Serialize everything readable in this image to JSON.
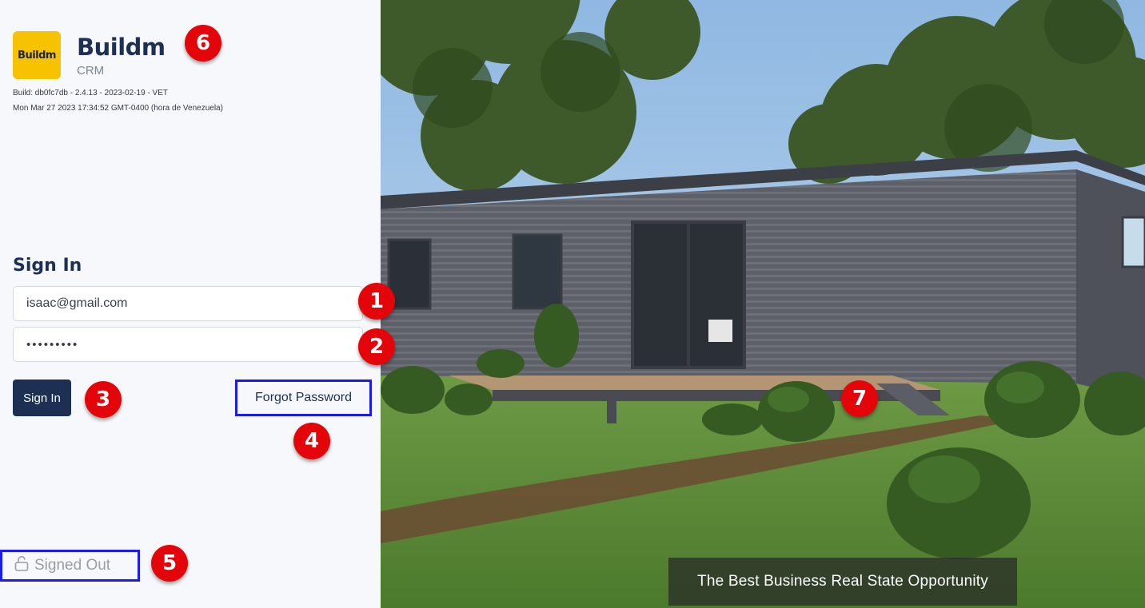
{
  "brand": {
    "logo_text": "Buildm",
    "title": "Buildm",
    "subtitle": "CRM",
    "build_info": "Build: db0fc7db - 2.4.13 - 2023-02-19 - VET",
    "date_info": "Mon Mar 27 2023 17:34:52 GMT-0400 (hora de Venezuela)"
  },
  "signin": {
    "heading": "Sign In",
    "email_value": "isaac@gmail.com",
    "password_value": "•••••••••",
    "button_label": "Sign In",
    "forgot_label": "Forgot Password"
  },
  "status": {
    "icon": "lock-open-icon",
    "label": "Signed Out"
  },
  "hero": {
    "caption": "The Best Business Real State Opportunity"
  },
  "annotations": [
    "1",
    "2",
    "3",
    "4",
    "5",
    "6",
    "7"
  ],
  "colors": {
    "primary": "#1e2f54",
    "logo_bg": "#f7c200",
    "badge": "#e4050a",
    "highlight_border": "#1b1bf0"
  }
}
